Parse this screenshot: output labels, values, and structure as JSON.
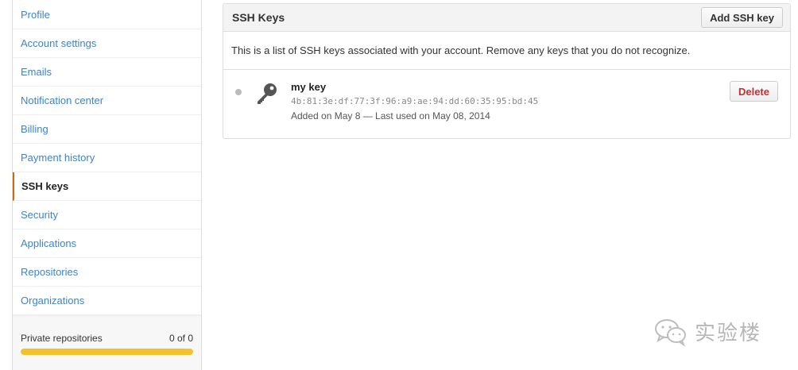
{
  "sidebar": {
    "items": [
      {
        "label": "Profile"
      },
      {
        "label": "Account settings"
      },
      {
        "label": "Emails"
      },
      {
        "label": "Notification center"
      },
      {
        "label": "Billing"
      },
      {
        "label": "Payment history"
      },
      {
        "label": "SSH keys",
        "selected": true
      },
      {
        "label": "Security"
      },
      {
        "label": "Applications"
      },
      {
        "label": "Repositories"
      },
      {
        "label": "Organizations"
      }
    ],
    "private_repos": {
      "label": "Private repositories",
      "count": "0 of 0",
      "usage_fraction": 1.0,
      "bar_color": "#f5c12a"
    }
  },
  "panel": {
    "title": "SSH Keys",
    "add_button": "Add SSH key",
    "description": "This is a list of SSH keys associated with your account. Remove any keys that you do not recognize.",
    "keys": [
      {
        "title": "my key",
        "fingerprint": "4b:81:3e:df:77:3f:96:a9:ae:94:dd:60:35:95:bd:45",
        "meta": "Added on May 8 — Last used on May 08, 2014",
        "delete_label": "Delete",
        "icon": "key-icon",
        "status_icon": "status-dot"
      }
    ]
  },
  "watermark": {
    "text": "实验楼",
    "icon": "wechat-icon"
  },
  "colors": {
    "link": "#4183c4",
    "selected_border": "#d26911",
    "delete": "#b33333"
  }
}
